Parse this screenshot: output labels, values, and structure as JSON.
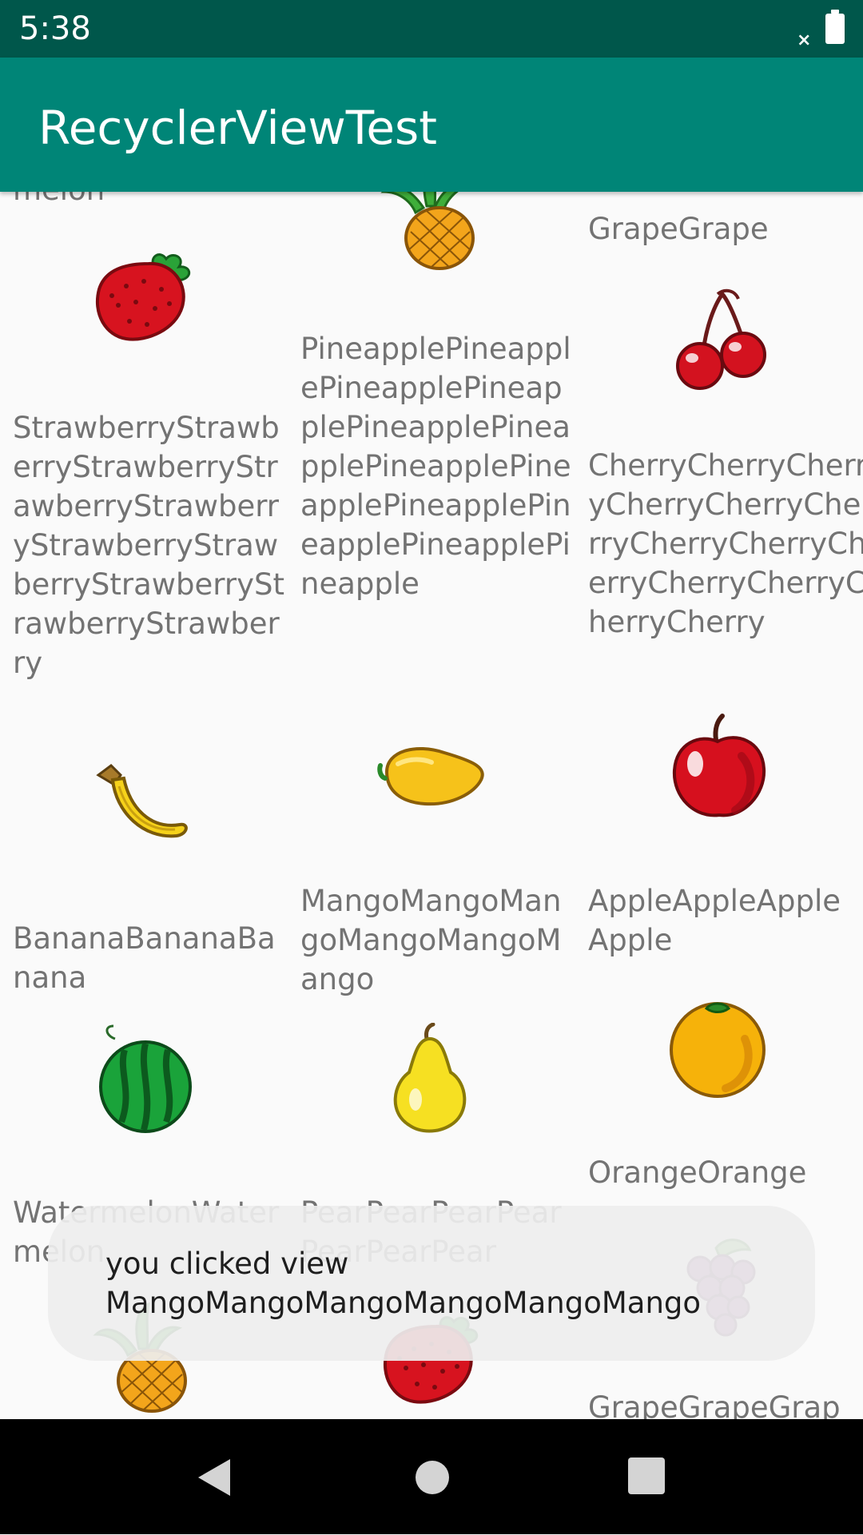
{
  "status_bar": {
    "time": "5:38",
    "signal_mark": "×"
  },
  "app_bar": {
    "title": "RecyclerViewTest"
  },
  "grid": {
    "items": [
      {
        "icon": "watermelon-icon",
        "label": "melon"
      },
      {
        "icon": "pineapple-icon",
        "label": ""
      },
      {
        "icon": "grape-icon",
        "label": "GrapeGrape"
      },
      {
        "icon": "strawberry-icon",
        "label": "StrawberryStrawberryStrawberryStrawberryStrawberryStrawberryStrawberryStrawberryStrawberryStrawberry"
      },
      {
        "icon": "pineapple-icon",
        "label": "PineapplePineapplePineapplePineapplePineapplePineapplePineapplePineapplePineapplePineapplePineapplePineapple"
      },
      {
        "icon": "cherry-icon",
        "label": "CherryCherryCherryCherryCherryCherryCherryCherryCherryCherryCherryCherryCherry"
      },
      {
        "icon": "banana-icon",
        "label": "BananaBananaBanana"
      },
      {
        "icon": "mango-icon",
        "label": "MangoMangoMangoMangoMangoMango"
      },
      {
        "icon": "apple-icon",
        "label": "AppleAppleAppleApple"
      },
      {
        "icon": "watermelon-icon",
        "label": "WatermelonWatermelon"
      },
      {
        "icon": "pear-icon",
        "label": "PearPearPearPearPearPearPear"
      },
      {
        "icon": "orange-icon",
        "label": "OrangeOrange"
      },
      {
        "icon": "pineapple-icon",
        "label": ""
      },
      {
        "icon": "strawberry-icon",
        "label": ""
      },
      {
        "icon": "grape-icon",
        "label": "GrapeGrapeGrap"
      }
    ]
  },
  "toast": {
    "message": "you clicked view MangoMangoMangoMangoMangoMango"
  },
  "colors": {
    "status_bar": "#00574b",
    "app_bar": "#008577",
    "label_text": "#737373",
    "toast_background": "#eeeeee",
    "nav_bar": "#000000"
  },
  "nav_bar": {
    "buttons": [
      "back-icon",
      "home-icon",
      "recent-apps-icon"
    ]
  }
}
